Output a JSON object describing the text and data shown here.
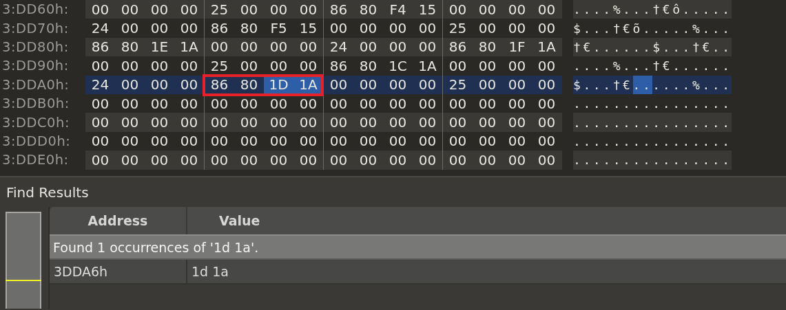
{
  "hex_view": {
    "rows": [
      {
        "address": "3:DD60h:",
        "selected": false,
        "bytes": [
          {
            "value": "00",
            "selected": false
          },
          {
            "value": "00",
            "selected": false
          },
          {
            "value": "00",
            "selected": false
          },
          {
            "value": "00",
            "selected": false
          },
          {
            "value": "25",
            "selected": false
          },
          {
            "value": "00",
            "selected": false
          },
          {
            "value": "00",
            "selected": false
          },
          {
            "value": "00",
            "selected": false
          },
          {
            "value": "86",
            "selected": false
          },
          {
            "value": "80",
            "selected": false
          },
          {
            "value": "F4",
            "selected": false
          },
          {
            "value": "15",
            "selected": false
          },
          {
            "value": "00",
            "selected": false
          },
          {
            "value": "00",
            "selected": false
          },
          {
            "value": "00",
            "selected": false
          },
          {
            "value": "00",
            "selected": false
          }
        ],
        "ascii": [
          {
            "text": "....%...†€ô.....",
            "selected": false
          }
        ]
      },
      {
        "address": "3:DD70h:",
        "selected": false,
        "bytes": [
          {
            "value": "24",
            "selected": false
          },
          {
            "value": "00",
            "selected": false
          },
          {
            "value": "00",
            "selected": false
          },
          {
            "value": "00",
            "selected": false
          },
          {
            "value": "86",
            "selected": false
          },
          {
            "value": "80",
            "selected": false
          },
          {
            "value": "F5",
            "selected": false
          },
          {
            "value": "15",
            "selected": false
          },
          {
            "value": "00",
            "selected": false
          },
          {
            "value": "00",
            "selected": false
          },
          {
            "value": "00",
            "selected": false
          },
          {
            "value": "00",
            "selected": false
          },
          {
            "value": "25",
            "selected": false
          },
          {
            "value": "00",
            "selected": false
          },
          {
            "value": "00",
            "selected": false
          },
          {
            "value": "00",
            "selected": false
          }
        ],
        "ascii": [
          {
            "text": "$...†€õ.....%...",
            "selected": false
          }
        ]
      },
      {
        "address": "3:DD80h:",
        "selected": false,
        "bytes": [
          {
            "value": "86",
            "selected": false
          },
          {
            "value": "80",
            "selected": false
          },
          {
            "value": "1E",
            "selected": false
          },
          {
            "value": "1A",
            "selected": false
          },
          {
            "value": "00",
            "selected": false
          },
          {
            "value": "00",
            "selected": false
          },
          {
            "value": "00",
            "selected": false
          },
          {
            "value": "00",
            "selected": false
          },
          {
            "value": "24",
            "selected": false
          },
          {
            "value": "00",
            "selected": false
          },
          {
            "value": "00",
            "selected": false
          },
          {
            "value": "00",
            "selected": false
          },
          {
            "value": "86",
            "selected": false
          },
          {
            "value": "80",
            "selected": false
          },
          {
            "value": "1F",
            "selected": false
          },
          {
            "value": "1A",
            "selected": false
          }
        ],
        "ascii": [
          {
            "text": "†€......$...†€..",
            "selected": false
          }
        ]
      },
      {
        "address": "3:DD90h:",
        "selected": false,
        "bytes": [
          {
            "value": "00",
            "selected": false
          },
          {
            "value": "00",
            "selected": false
          },
          {
            "value": "00",
            "selected": false
          },
          {
            "value": "00",
            "selected": false
          },
          {
            "value": "25",
            "selected": false
          },
          {
            "value": "00",
            "selected": false
          },
          {
            "value": "00",
            "selected": false
          },
          {
            "value": "00",
            "selected": false
          },
          {
            "value": "86",
            "selected": false
          },
          {
            "value": "80",
            "selected": false
          },
          {
            "value": "1C",
            "selected": false
          },
          {
            "value": "1A",
            "selected": false
          },
          {
            "value": "00",
            "selected": false
          },
          {
            "value": "00",
            "selected": false
          },
          {
            "value": "00",
            "selected": false
          },
          {
            "value": "00",
            "selected": false
          }
        ],
        "ascii": [
          {
            "text": "....%...†€......",
            "selected": false
          }
        ]
      },
      {
        "address": "3:DDA0h:",
        "selected": true,
        "bytes": [
          {
            "value": "24",
            "selected": false
          },
          {
            "value": "00",
            "selected": false
          },
          {
            "value": "00",
            "selected": false
          },
          {
            "value": "00",
            "selected": false
          },
          {
            "value": "86",
            "selected": false
          },
          {
            "value": "80",
            "selected": false
          },
          {
            "value": "1D",
            "selected": true
          },
          {
            "value": "1A",
            "selected": true
          },
          {
            "value": "00",
            "selected": false
          },
          {
            "value": "00",
            "selected": false
          },
          {
            "value": "00",
            "selected": false
          },
          {
            "value": "00",
            "selected": false
          },
          {
            "value": "25",
            "selected": false
          },
          {
            "value": "00",
            "selected": false
          },
          {
            "value": "00",
            "selected": false
          },
          {
            "value": "00",
            "selected": false
          }
        ],
        "ascii": [
          {
            "text": "$...†€",
            "selected": false
          },
          {
            "text": "..",
            "selected": true
          },
          {
            "text": "....%...",
            "selected": false
          }
        ]
      },
      {
        "address": "3:DDB0h:",
        "selected": false,
        "bytes": [
          {
            "value": "00",
            "selected": false
          },
          {
            "value": "00",
            "selected": false
          },
          {
            "value": "00",
            "selected": false
          },
          {
            "value": "00",
            "selected": false
          },
          {
            "value": "00",
            "selected": false
          },
          {
            "value": "00",
            "selected": false
          },
          {
            "value": "00",
            "selected": false
          },
          {
            "value": "00",
            "selected": false
          },
          {
            "value": "00",
            "selected": false
          },
          {
            "value": "00",
            "selected": false
          },
          {
            "value": "00",
            "selected": false
          },
          {
            "value": "00",
            "selected": false
          },
          {
            "value": "00",
            "selected": false
          },
          {
            "value": "00",
            "selected": false
          },
          {
            "value": "00",
            "selected": false
          },
          {
            "value": "00",
            "selected": false
          }
        ],
        "ascii": [
          {
            "text": "................",
            "selected": false
          }
        ]
      },
      {
        "address": "3:DDC0h:",
        "selected": false,
        "bytes": [
          {
            "value": "00",
            "selected": false
          },
          {
            "value": "00",
            "selected": false
          },
          {
            "value": "00",
            "selected": false
          },
          {
            "value": "00",
            "selected": false
          },
          {
            "value": "00",
            "selected": false
          },
          {
            "value": "00",
            "selected": false
          },
          {
            "value": "00",
            "selected": false
          },
          {
            "value": "00",
            "selected": false
          },
          {
            "value": "00",
            "selected": false
          },
          {
            "value": "00",
            "selected": false
          },
          {
            "value": "00",
            "selected": false
          },
          {
            "value": "00",
            "selected": false
          },
          {
            "value": "00",
            "selected": false
          },
          {
            "value": "00",
            "selected": false
          },
          {
            "value": "00",
            "selected": false
          },
          {
            "value": "00",
            "selected": false
          }
        ],
        "ascii": [
          {
            "text": "................",
            "selected": false
          }
        ]
      },
      {
        "address": "3:DDD0h:",
        "selected": false,
        "bytes": [
          {
            "value": "00",
            "selected": false
          },
          {
            "value": "00",
            "selected": false
          },
          {
            "value": "00",
            "selected": false
          },
          {
            "value": "00",
            "selected": false
          },
          {
            "value": "00",
            "selected": false
          },
          {
            "value": "00",
            "selected": false
          },
          {
            "value": "00",
            "selected": false
          },
          {
            "value": "00",
            "selected": false
          },
          {
            "value": "00",
            "selected": false
          },
          {
            "value": "00",
            "selected": false
          },
          {
            "value": "00",
            "selected": false
          },
          {
            "value": "00",
            "selected": false
          },
          {
            "value": "00",
            "selected": false
          },
          {
            "value": "00",
            "selected": false
          },
          {
            "value": "00",
            "selected": false
          },
          {
            "value": "00",
            "selected": false
          }
        ],
        "ascii": [
          {
            "text": "................",
            "selected": false
          }
        ]
      },
      {
        "address": "3:DDE0h:",
        "selected": false,
        "bytes": [
          {
            "value": "00",
            "selected": false
          },
          {
            "value": "00",
            "selected": false
          },
          {
            "value": "00",
            "selected": false
          },
          {
            "value": "00",
            "selected": false
          },
          {
            "value": "00",
            "selected": false
          },
          {
            "value": "00",
            "selected": false
          },
          {
            "value": "00",
            "selected": false
          },
          {
            "value": "00",
            "selected": false
          },
          {
            "value": "00",
            "selected": false
          },
          {
            "value": "00",
            "selected": false
          },
          {
            "value": "00",
            "selected": false
          },
          {
            "value": "00",
            "selected": false
          },
          {
            "value": "00",
            "selected": false
          },
          {
            "value": "00",
            "selected": false
          },
          {
            "value": "00",
            "selected": false
          },
          {
            "value": "00",
            "selected": false
          }
        ],
        "ascii": [
          {
            "text": "................",
            "selected": false
          }
        ]
      }
    ]
  },
  "find_results": {
    "title": "Find Results",
    "columns": [
      "Address",
      "Value"
    ],
    "message": "Found 1 occurrences of '1d 1a'.",
    "rows": [
      {
        "address": "3DDA6h",
        "value": "1d 1a"
      }
    ]
  }
}
